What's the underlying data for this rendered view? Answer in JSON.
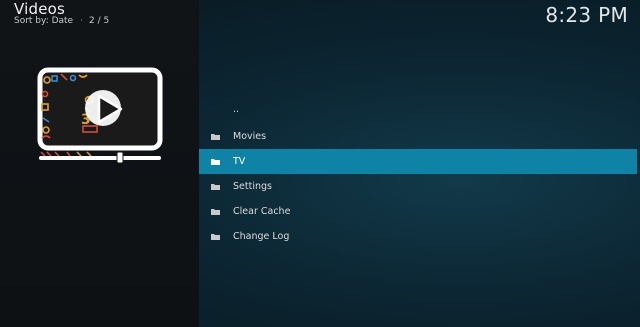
{
  "header": {
    "title": "Videos",
    "sort_label": "Sort by: Date",
    "separator": "·",
    "position": "2 / 5"
  },
  "clock": "8:23 PM",
  "list": {
    "items": [
      {
        "label": "..",
        "icon": "none"
      },
      {
        "label": "Movies",
        "icon": "folder-icon"
      },
      {
        "label": "TV",
        "icon": "folder-icon",
        "selected": true
      },
      {
        "label": "Settings",
        "icon": "folder-icon"
      },
      {
        "label": "Clear Cache",
        "icon": "folder-icon"
      },
      {
        "label": "Change Log",
        "icon": "folder-icon"
      }
    ]
  },
  "colors": {
    "selection": "#0e83a6",
    "text": "#dcdcdc",
    "left_panel": "#101417"
  }
}
